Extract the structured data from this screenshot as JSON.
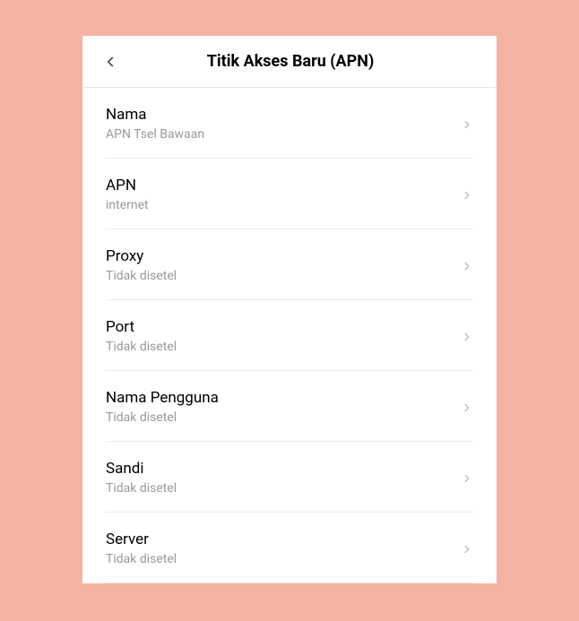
{
  "header": {
    "title": "Titik Akses Baru (APN)"
  },
  "settings": [
    {
      "label": "Nama",
      "value": "APN Tsel Bawaan"
    },
    {
      "label": "APN",
      "value": "internet"
    },
    {
      "label": "Proxy",
      "value": "Tidak disetel"
    },
    {
      "label": "Port",
      "value": "Tidak disetel"
    },
    {
      "label": "Nama Pengguna",
      "value": "Tidak disetel"
    },
    {
      "label": "Sandi",
      "value": "Tidak disetel"
    },
    {
      "label": "Server",
      "value": "Tidak disetel"
    }
  ]
}
